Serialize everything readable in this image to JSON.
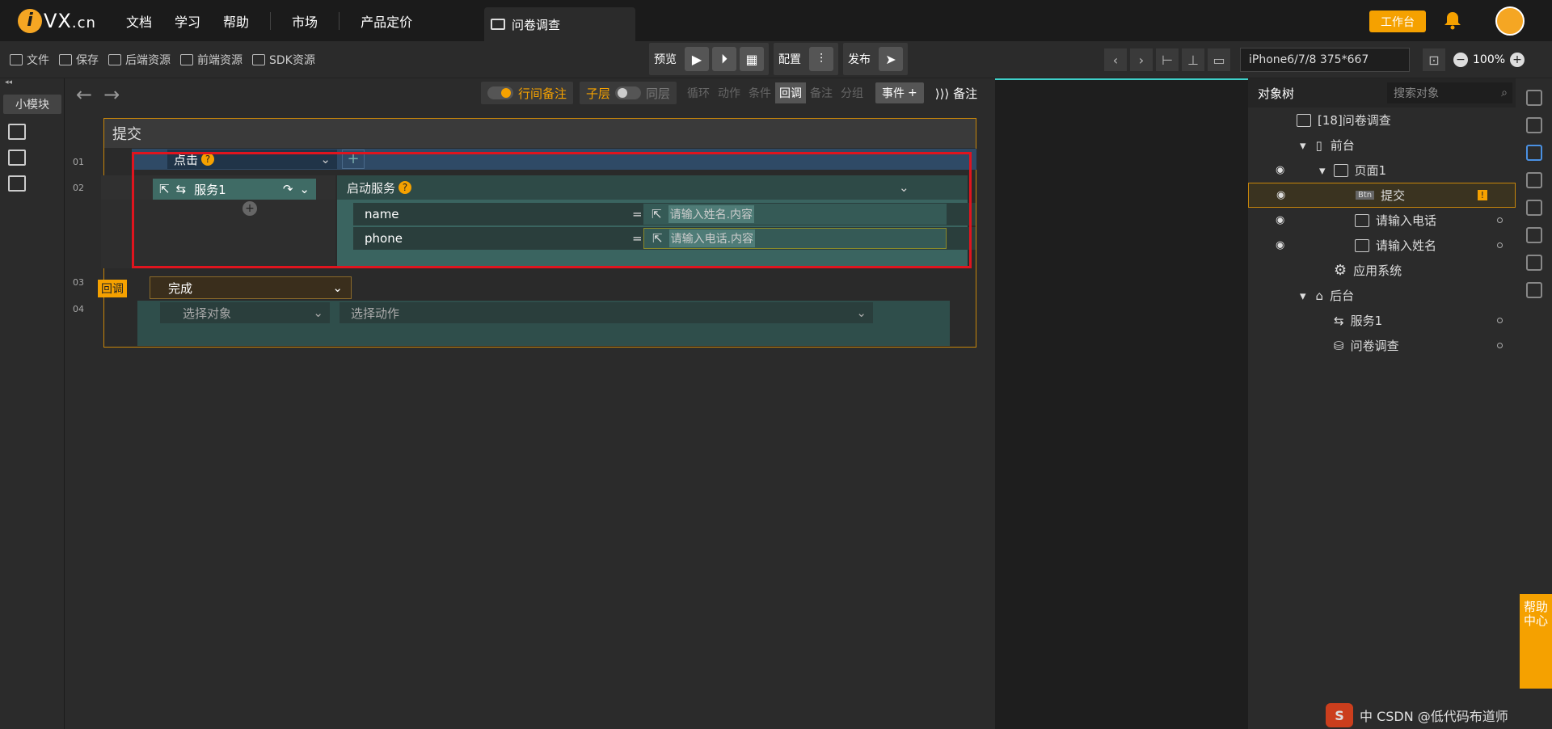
{
  "topbar": {
    "logo_text": "VX",
    "logo_suffix": ".cn",
    "nav": [
      "文档",
      "学习",
      "帮助",
      "市场",
      "产品定价"
    ],
    "active_tab": "问卷调查",
    "workbench": "工作台"
  },
  "toolbar": {
    "items": [
      "文件",
      "保存",
      "后端资源",
      "前端资源",
      "SDK资源"
    ],
    "preview": "预览",
    "config": "配置",
    "publish": "发布",
    "device": "iPhone6/7/8 375*667",
    "zoom": "100%"
  },
  "left": {
    "small_module": "小模块"
  },
  "editor": {
    "inline_note": "行间备注",
    "child_layer": "子层",
    "same_layer": "同层",
    "tabs": [
      "循环",
      "动作",
      "条件",
      "回调",
      "备注",
      "分组"
    ],
    "active_tab": "回调",
    "event_btn": "事件",
    "notes_btn": "备注",
    "frame_title": "提交",
    "rows": {
      "r1_num": "01",
      "r2_num": "02",
      "r3_num": "03",
      "r4_num": "04",
      "trigger": "点击",
      "service": "服务1",
      "action": "启动服务",
      "params": [
        {
          "name": "name",
          "value": "请输入姓名.内容"
        },
        {
          "name": "phone",
          "value": "请输入电话.内容"
        }
      ],
      "callback_tag": "回调",
      "callback_event": "完成",
      "select_object": "选择对象",
      "select_action": "选择动作"
    }
  },
  "object_tree": {
    "title": "对象树",
    "search_placeholder": "搜索对象",
    "items": [
      {
        "label": "[18]问卷调查"
      },
      {
        "label": "前台"
      },
      {
        "label": "页面1"
      },
      {
        "label": "提交"
      },
      {
        "label": "请输入电话"
      },
      {
        "label": "请输入姓名"
      },
      {
        "label": "应用系统"
      },
      {
        "label": "后台"
      },
      {
        "label": "服务1"
      },
      {
        "label": "问卷调查"
      }
    ]
  },
  "help": "帮助中心",
  "watermark": "中 CSDN @低代码布道师",
  "colors": {
    "accent": "#f5a100",
    "highlight_border": "#e0141e",
    "teal": "#3fd0c9"
  }
}
